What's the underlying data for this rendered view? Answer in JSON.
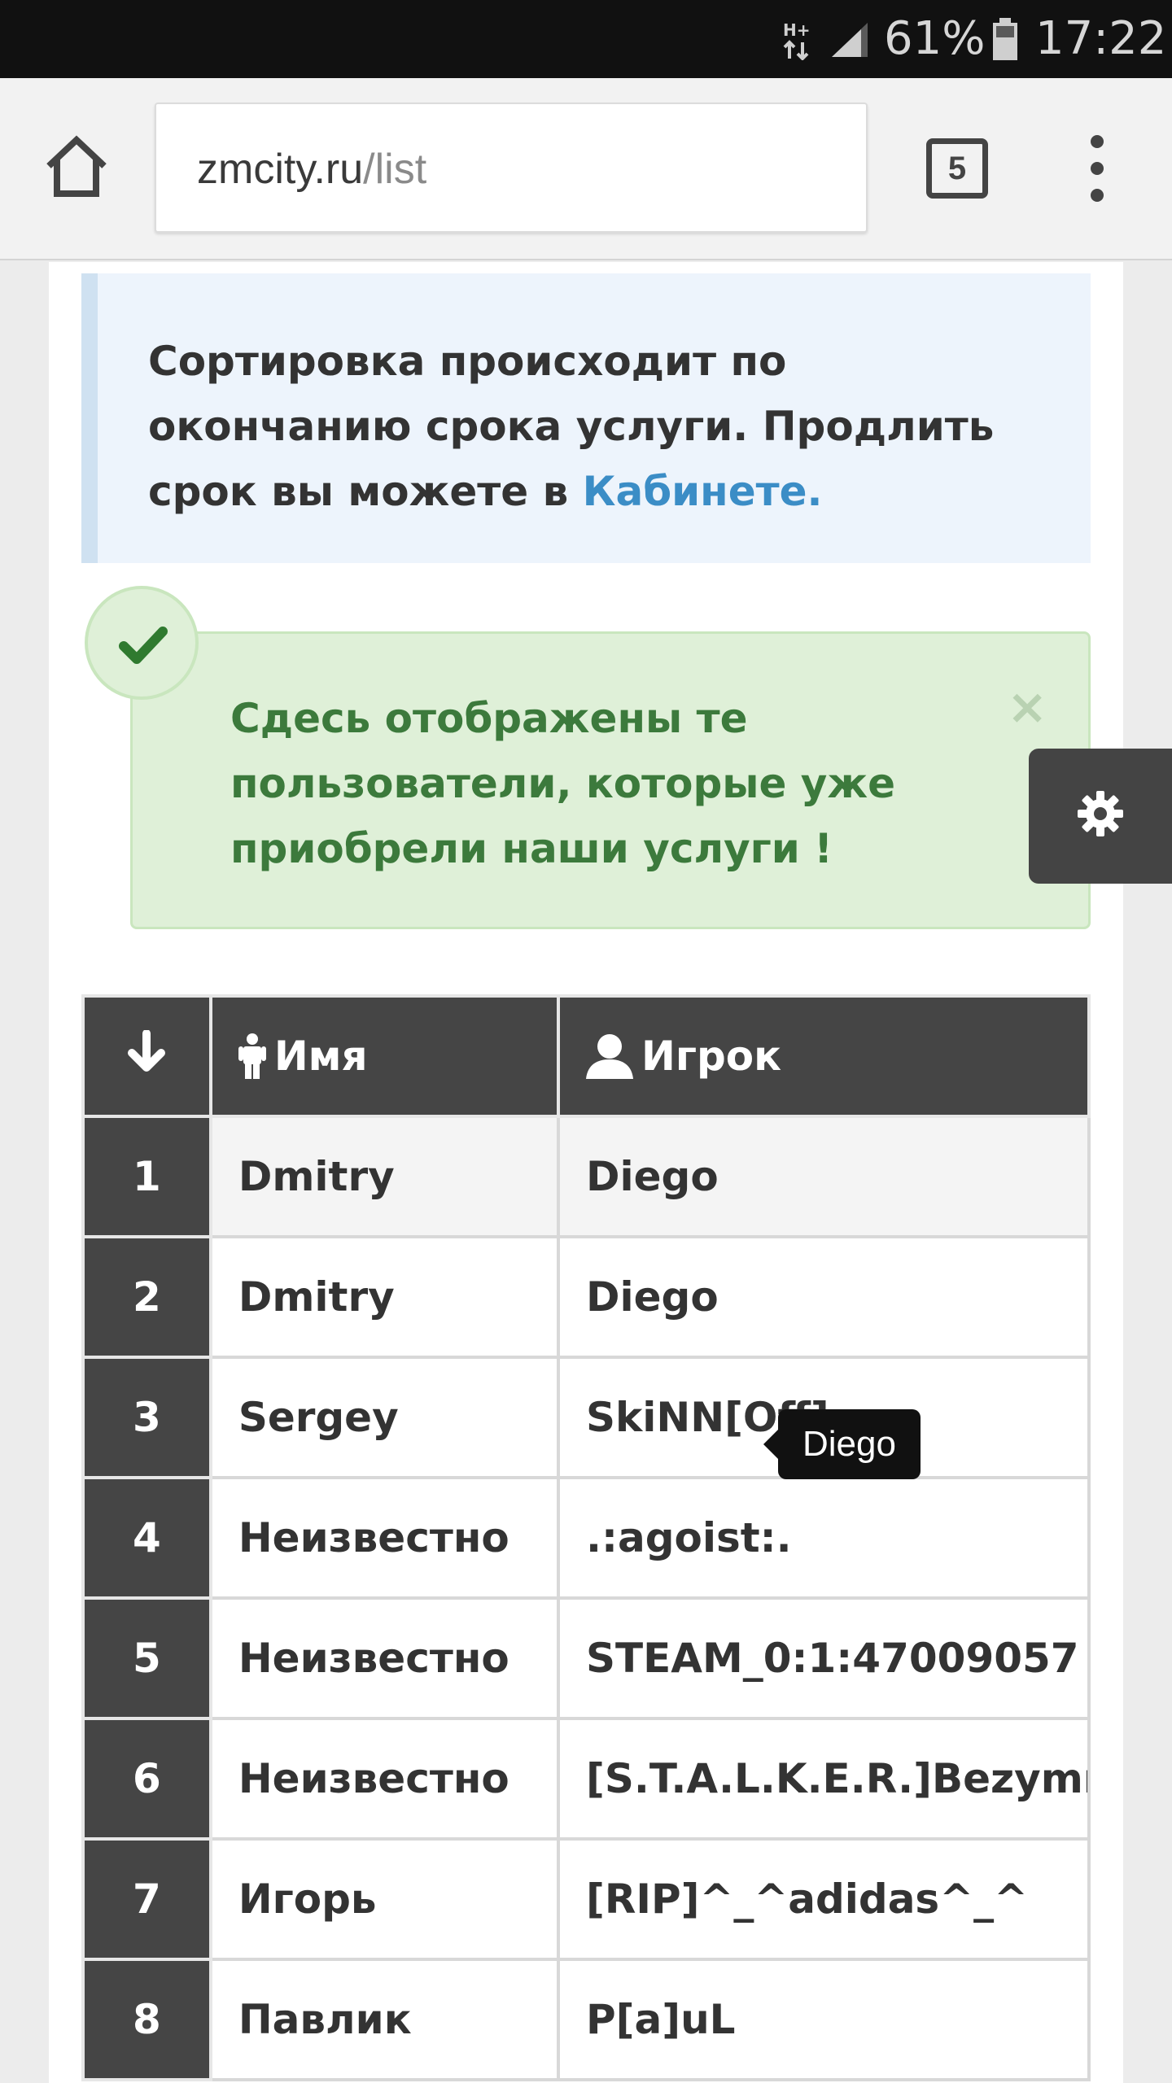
{
  "status_bar": {
    "network_type": "H+",
    "battery_percent": "61%",
    "time": "17:22"
  },
  "browser": {
    "url_domain": "zmcity.ru",
    "url_path": "/list",
    "tab_count": "5",
    "home_icon": "home-icon",
    "menu_icon": "overflow-menu-icon"
  },
  "info": {
    "text": "Сортировка происходит по окончанию срока услуги. Продлить срок вы можете в ",
    "link": "Кабинете."
  },
  "success": {
    "text": "Сдесь отображены те пользователи, которые уже приобрели наши услуги !",
    "close": "×"
  },
  "settings_tab": {
    "icon": "gear-icon"
  },
  "table": {
    "headers": {
      "num_icon": "arrow-down-icon",
      "name": "Имя",
      "player": "Игрок"
    },
    "rows": [
      {
        "n": "1",
        "name": "Dmitry",
        "player": "Diego"
      },
      {
        "n": "2",
        "name": "Dmitry",
        "player": "Diego"
      },
      {
        "n": "3",
        "name": "Sergey",
        "player": "SkiNN[Off]"
      },
      {
        "n": "4",
        "name": "Неизвестно",
        "player": ".:agoist:."
      },
      {
        "n": "5",
        "name": "Неизвестно",
        "player": "STEAM_0:1:47009057"
      },
      {
        "n": "6",
        "name": "Неизвестно",
        "player": "[S.T.A.L.K.E.R.]Bezymnii_"
      },
      {
        "n": "7",
        "name": "Игорь",
        "player": "[RIP]^_^adidas^_^"
      },
      {
        "n": "8",
        "name": "Павлик",
        "player": "P[a]uL"
      }
    ]
  },
  "tooltip": {
    "text": "Diego"
  }
}
